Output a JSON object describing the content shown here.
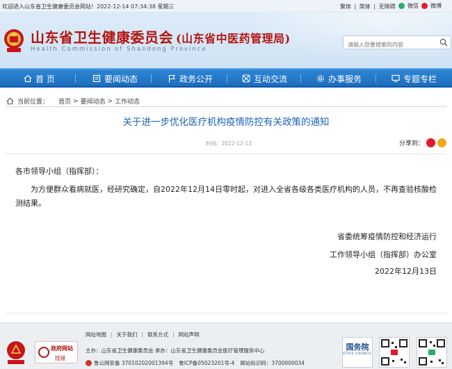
{
  "topbar": {
    "welcome": "欢迎进入山东省卫生健康委员会网站！2022-12-14 07:34:38 星期三",
    "links": [
      "繁体",
      "|",
      "简体",
      "|",
      "无障碍"
    ],
    "wechat": "微信",
    "weibo": "微博"
  },
  "header": {
    "title": "山东省卫生健康委员会",
    "subtitle": "(山东省中医药管理局)",
    "english": "Health Commission of Shandong Province",
    "search_placeholder": "请输入您要搜索的内容"
  },
  "nav": [
    {
      "label": "首 页",
      "icon": "home-icon"
    },
    {
      "label": "要闻动态",
      "icon": "news-icon"
    },
    {
      "label": "政务公开",
      "icon": "flag-icon"
    },
    {
      "label": "互动交流",
      "icon": "interact-icon"
    },
    {
      "label": "办事服务",
      "icon": "gear-icon"
    },
    {
      "label": "专题专栏",
      "icon": "monitor-icon"
    }
  ],
  "breadcrumb": {
    "label": "当前位置：",
    "items": [
      "首页",
      ">",
      "要闻动态",
      ">",
      "工作动态"
    ]
  },
  "article": {
    "title": "关于进一步优化医疗机构疫情防控有关政策的通知",
    "time": "时间：2022-12-13",
    "share_label": "分享到：",
    "salutation": "各市领导小组（指挥部）：",
    "paragraph": "为方便群众看病就医，经研究确定，自2022年12月14日零时起，对进入全省各级各类医疗机构的人员，不再查验核酸检测结果。",
    "sign_line1": "省委统筹疫情防控和经济运行",
    "sign_line2": "工作领导小组（指挥部）办公室",
    "date": "2022年12月13日"
  },
  "footer": {
    "links": [
      "网站地图",
      "关于我们",
      "联系方式",
      "网站声明"
    ],
    "host": "主办：山东省卫生健康委员会  承办：山东省卫生健康委员会医疗管理服务中心",
    "police_record": "鲁公网安备 37010202001394号",
    "icp_record": "鲁ICP备05023201号-4",
    "site_code": "网站标识码：3700000034",
    "gov_find_line1": "政府网站",
    "gov_find_line2": "找错",
    "council_cn": "国务院",
    "council_en": "STATE COUNCIL"
  },
  "colors": {
    "nav_blue": "#1c6cbd",
    "title_red": "#b3140f",
    "article_title_blue": "#1b63b5"
  }
}
